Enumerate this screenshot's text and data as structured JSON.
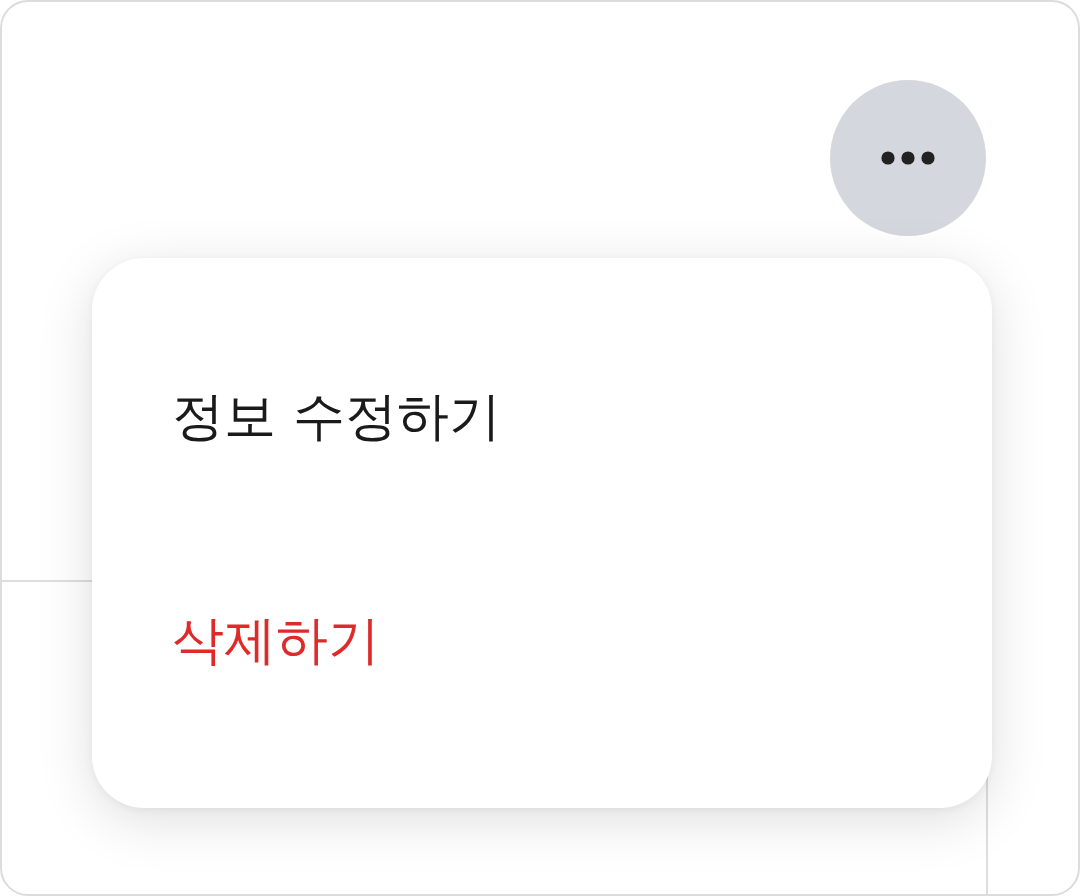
{
  "menu": {
    "items": [
      {
        "label": "정보 수정하기",
        "kind": "normal"
      },
      {
        "label": "삭제하기",
        "kind": "destructive"
      }
    ]
  }
}
